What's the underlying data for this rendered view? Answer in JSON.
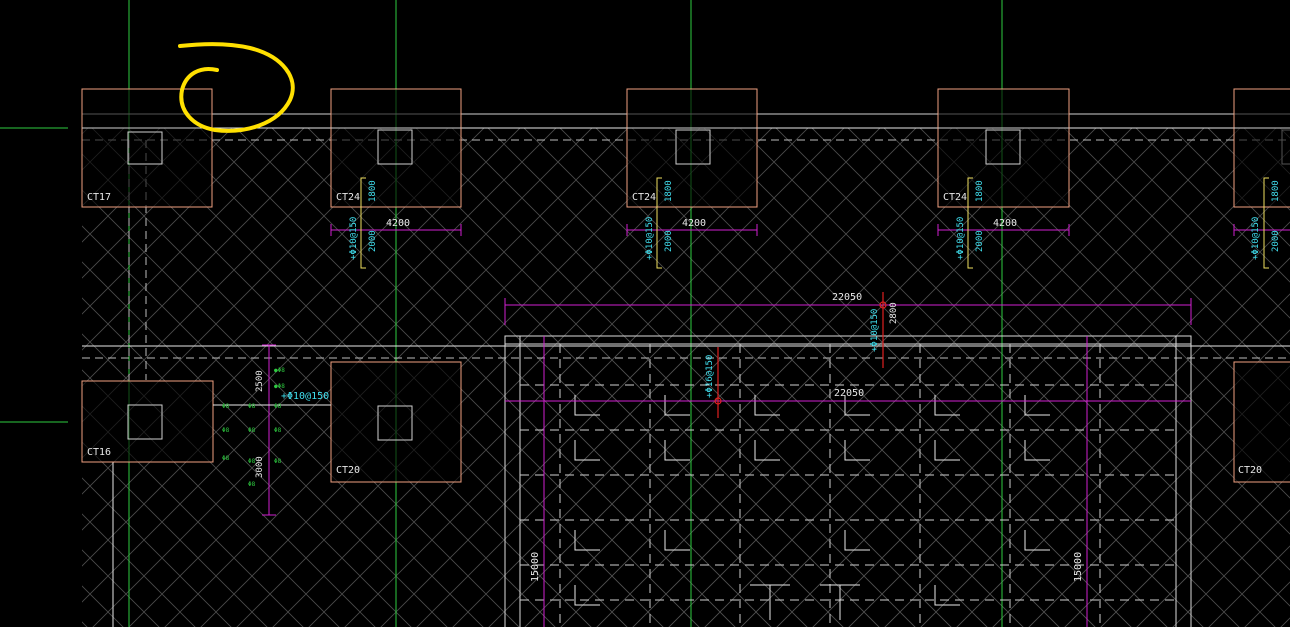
{
  "colors": {
    "background": "#000000",
    "axis_green": "#2ecc40",
    "pile_cap_outline": "#f0a080",
    "magenta_dimension": "#d020d0",
    "cyan_text": "#40e0f0",
    "yellow_bracket": "#f0e060",
    "red_rebar": "#e02020",
    "white_lines": "#e8e8e8",
    "grey_hatch": "#606060",
    "highlight_yellow": "#ffe000"
  },
  "pile_caps": {
    "top_left": "CT17",
    "top_1": "CT24",
    "top_2": "CT24",
    "top_3": "CT24",
    "mid_left": "CT16",
    "mid_1": "CT20",
    "mid_right": "CT20"
  },
  "dims": {
    "width_4200": "4200",
    "height_1800": "1800",
    "height_2000": "2000",
    "span_22050_top": "22050",
    "span_22050_mid": "22050",
    "height_2800": "2800",
    "dim_2500": "2500",
    "dim_3000": "3000",
    "dim_15000_left": "15000",
    "dim_15000_right": "15000"
  },
  "rebar": {
    "r10_150_a": "+Φ10@150",
    "r10_150_b": "+Φ10@150",
    "r10_150_c": "+Φ10@150",
    "r10_150_d": "+Φ10@150",
    "r10_150_mid": "+Φ10@150",
    "r10_150_span": "+Φ10@150",
    "r16_150": "+Φ16@150"
  },
  "annotation": {
    "kind": "hand-drawn yellow loop highlight"
  }
}
